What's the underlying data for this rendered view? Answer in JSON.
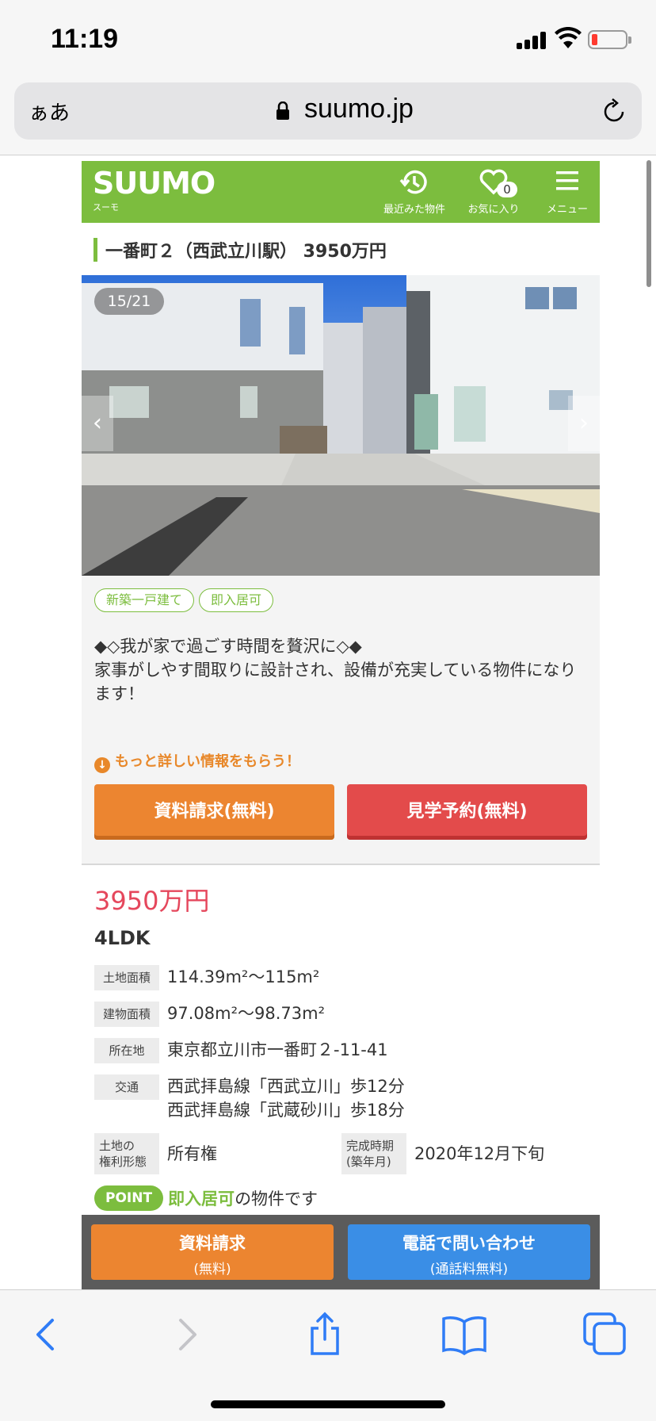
{
  "status": {
    "time": "11:19"
  },
  "browser": {
    "text_size": "ぁあ",
    "url": "suumo.jp"
  },
  "site": {
    "logo": "SUUMO",
    "logo_sub": "スーモ",
    "recent_label": "最近みた物件",
    "favorites_label": "お気に入り",
    "favorites_count": "0",
    "menu_label": "メニュー",
    "brand_color": "#7cbd3e"
  },
  "listing": {
    "title": "一番町２（西武立川駅） 3950万円",
    "photo_counter": "15/21",
    "tags": [
      "新築一戸建て",
      "即入居可"
    ],
    "description_line1": "◆◇我が家で過ごす時間を贅沢に◇◆",
    "description_line2": "家事がしやす間取りに設計され、設備が充実している物件になります！",
    "more_info": "もっと詳しい情報をもらう！",
    "request_button": "資料請求(無料)",
    "visit_button": "見学予約(無料)",
    "price": "3950万円",
    "layout": "4LDK",
    "specs": {
      "land_area_label": "土地面積",
      "land_area": "114.39m²〜115m²",
      "building_area_label": "建物面積",
      "building_area": "97.08m²〜98.73m²",
      "address_label": "所在地",
      "address": "東京都立川市一番町２-11-41",
      "transport_label": "交通",
      "transport_1": "西武拝島線「西武立川」歩12分",
      "transport_2": "西武拝島線「武蔵砂川」歩18分",
      "land_rights_label_1": "土地の",
      "land_rights_label_2": "権利形態",
      "land_rights": "所有権",
      "completion_label_1": "完成時期",
      "completion_label_2": "(築年月)",
      "completion": "2020年12月下旬"
    },
    "point_badge": "POINT",
    "point_highlight": "即入居可",
    "point_text": "の物件です"
  },
  "sticky": {
    "request_main": "資料請求",
    "request_sub": "(無料)",
    "phone_main": "電話で問い合わせ",
    "phone_sub": "(通話料無料)"
  },
  "icons": [
    "signal-icon",
    "wifi-icon",
    "battery-icon",
    "lock-icon",
    "reload-icon",
    "history-icon",
    "heart-icon",
    "menu-icon",
    "back-icon",
    "forward-icon",
    "share-icon",
    "bookmarks-icon",
    "tabs-icon"
  ]
}
